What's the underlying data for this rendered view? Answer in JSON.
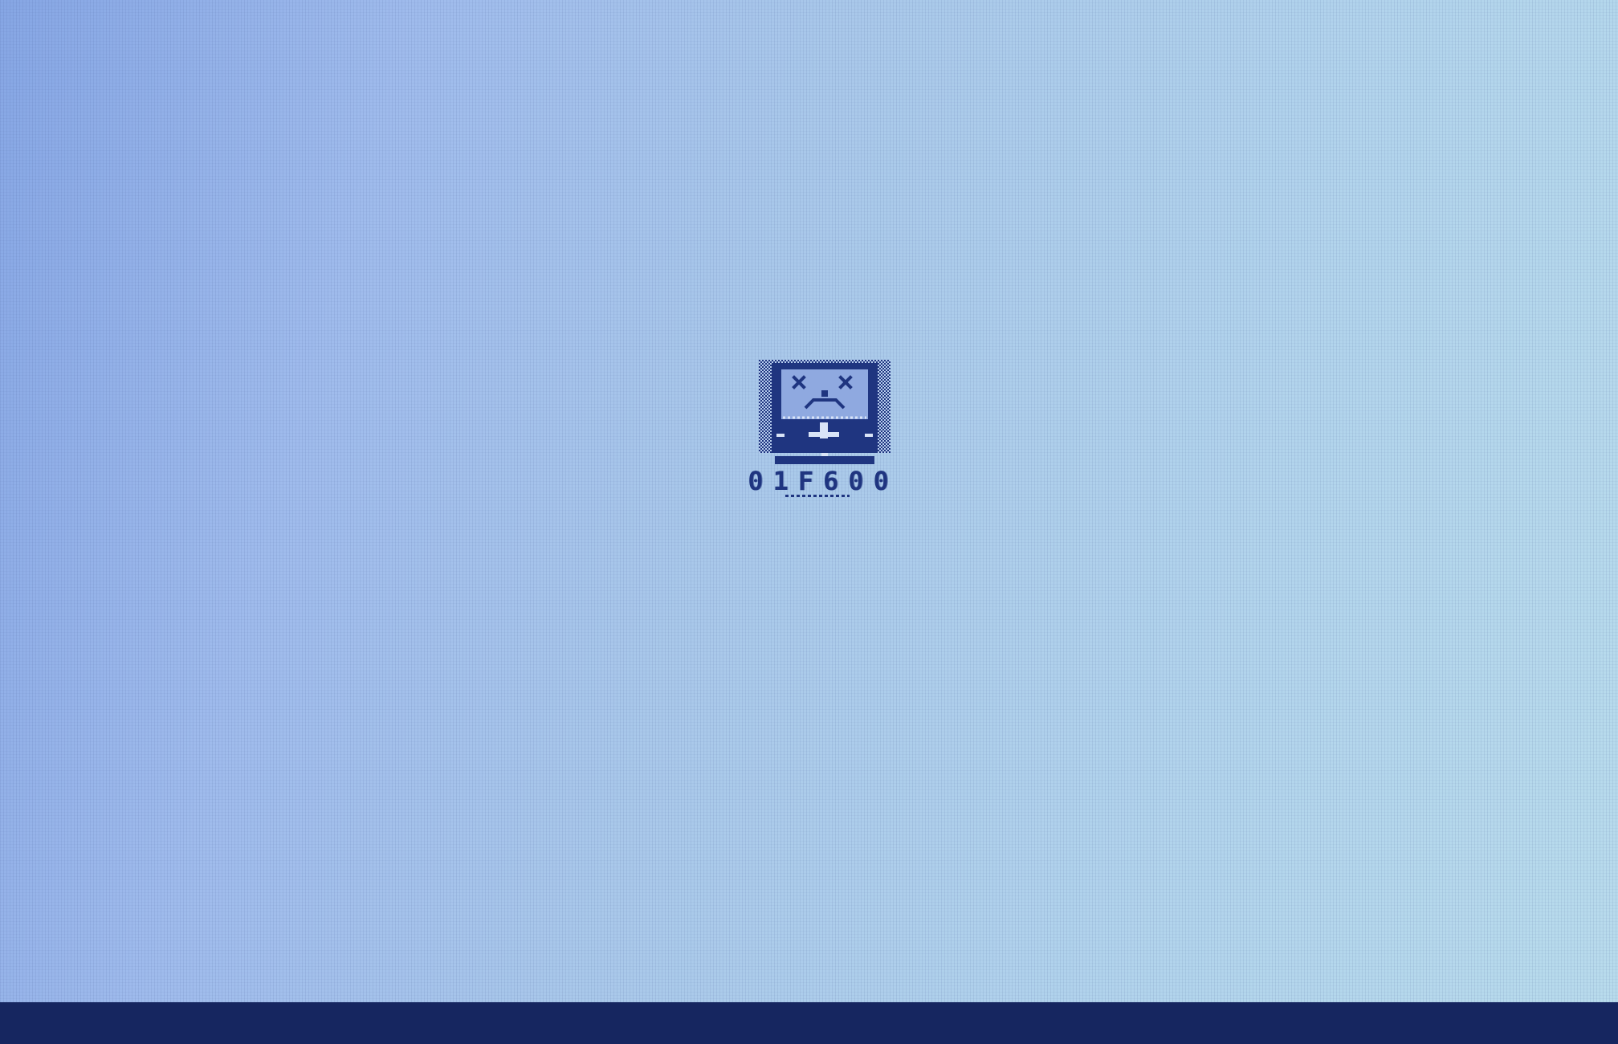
{
  "screen": {
    "background_color": "#a9c8ea",
    "bottom_bar_color": "#162660",
    "ink_color": "#1f3580"
  },
  "crash": {
    "icon": "sad-computer-icon",
    "code": "01F600"
  }
}
